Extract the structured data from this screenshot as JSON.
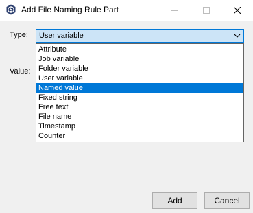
{
  "window": {
    "title": "Add File Naming Rule Part",
    "icons": {
      "app": "app-logo-icon",
      "minimize": "minimize-icon",
      "maximize": "maximize-icon",
      "close": "close-icon"
    }
  },
  "form": {
    "type_label": "Type:",
    "value_label": "Value:",
    "type_selected": "User variable"
  },
  "dropdown": {
    "items": [
      {
        "label": "Attribute",
        "selected": false
      },
      {
        "label": "Job variable",
        "selected": false
      },
      {
        "label": "Folder variable",
        "selected": false
      },
      {
        "label": "User variable",
        "selected": false
      },
      {
        "label": "Named value",
        "selected": true
      },
      {
        "label": "Fixed string",
        "selected": false
      },
      {
        "label": "Free text",
        "selected": false
      },
      {
        "label": "File name",
        "selected": false
      },
      {
        "label": "Timestamp",
        "selected": false
      },
      {
        "label": "Counter",
        "selected": false
      }
    ]
  },
  "buttons": {
    "add": "Add",
    "cancel": "Cancel"
  },
  "colors": {
    "accent": "#0078d7",
    "combo_bg": "#cce4f7",
    "highlight_text": "#ffffff"
  }
}
